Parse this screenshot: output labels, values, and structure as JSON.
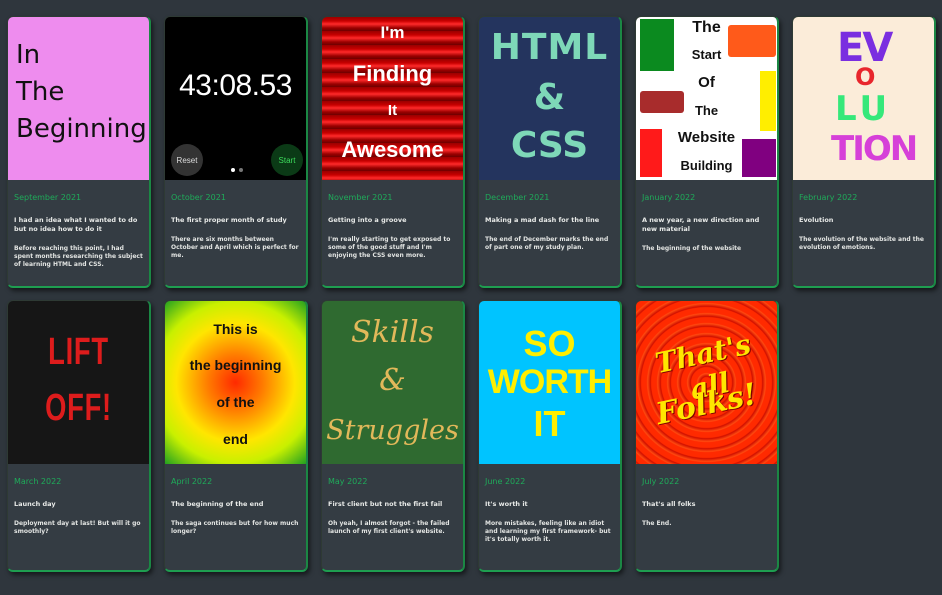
{
  "cards": [
    {
      "date": "September 2021",
      "title": "I had an idea what I wanted to do but no idea how to do it",
      "desc": "Before reaching this point, I had spent months researching the subject of learning HTML and CSS.",
      "image_text": [
        "In",
        "The",
        "Beginning"
      ]
    },
    {
      "date": "October 2021",
      "title": "The first proper month of study",
      "desc": "There are six months between October and April which is perfect for me.",
      "image_text": [
        "43:08.53",
        "Reset",
        "Start"
      ]
    },
    {
      "date": "November 2021",
      "title": "Getting into a groove",
      "desc": "I'm really starting to get exposed to some of the good stuff and I'm enjoying the CSS even more.",
      "image_text": [
        "I'm",
        "Finding",
        "It",
        "Awesome"
      ]
    },
    {
      "date": "December 2021",
      "title": "Making a mad dash for the line",
      "desc": "The end of December marks the end of part one of my study plan.",
      "image_text": [
        "HTML",
        "&",
        "CSS"
      ]
    },
    {
      "date": "January 2022",
      "title": "A new year, a new direction and new material",
      "desc": "The beginning of the website",
      "image_text": [
        "The",
        "Start",
        "Of",
        "The",
        "Website",
        "Building"
      ]
    },
    {
      "date": "February 2022",
      "title": "Evolution",
      "desc": "The evolution of the website and the evolution of emotions.",
      "image_text": [
        "EV",
        "O",
        "LU",
        "TION"
      ]
    },
    {
      "date": "March 2022",
      "title": "Launch day",
      "desc": "Deployment day at last! But will it go smoothly?",
      "image_text": [
        "LIFT",
        "OFF!"
      ]
    },
    {
      "date": "April 2022",
      "title": "The beginning of the end",
      "desc": "The saga continues but for how much longer?",
      "image_text": [
        "This is",
        "the beginning",
        "of the",
        "end"
      ]
    },
    {
      "date": "May 2022",
      "title": "First client but not the first fail",
      "desc": "Oh yeah, I almost forgot - the failed launch of my first client's website.",
      "image_text": [
        "Skills",
        "&",
        "Struggles"
      ]
    },
    {
      "date": "June 2022",
      "title": "It's worth it",
      "desc": "More mistakes, feeling like an idiot and learning my first framework- but it's totally worth it.",
      "image_text": [
        "SO",
        "WORTH",
        "IT"
      ]
    },
    {
      "date": "July 2022",
      "title": "That's all folks",
      "desc": "The End.",
      "image_text": [
        "That's all",
        "Folks!"
      ]
    }
  ],
  "colors": {
    "background": "#2f363d",
    "card": "#343c43",
    "accent_green": "#1fab5a"
  }
}
